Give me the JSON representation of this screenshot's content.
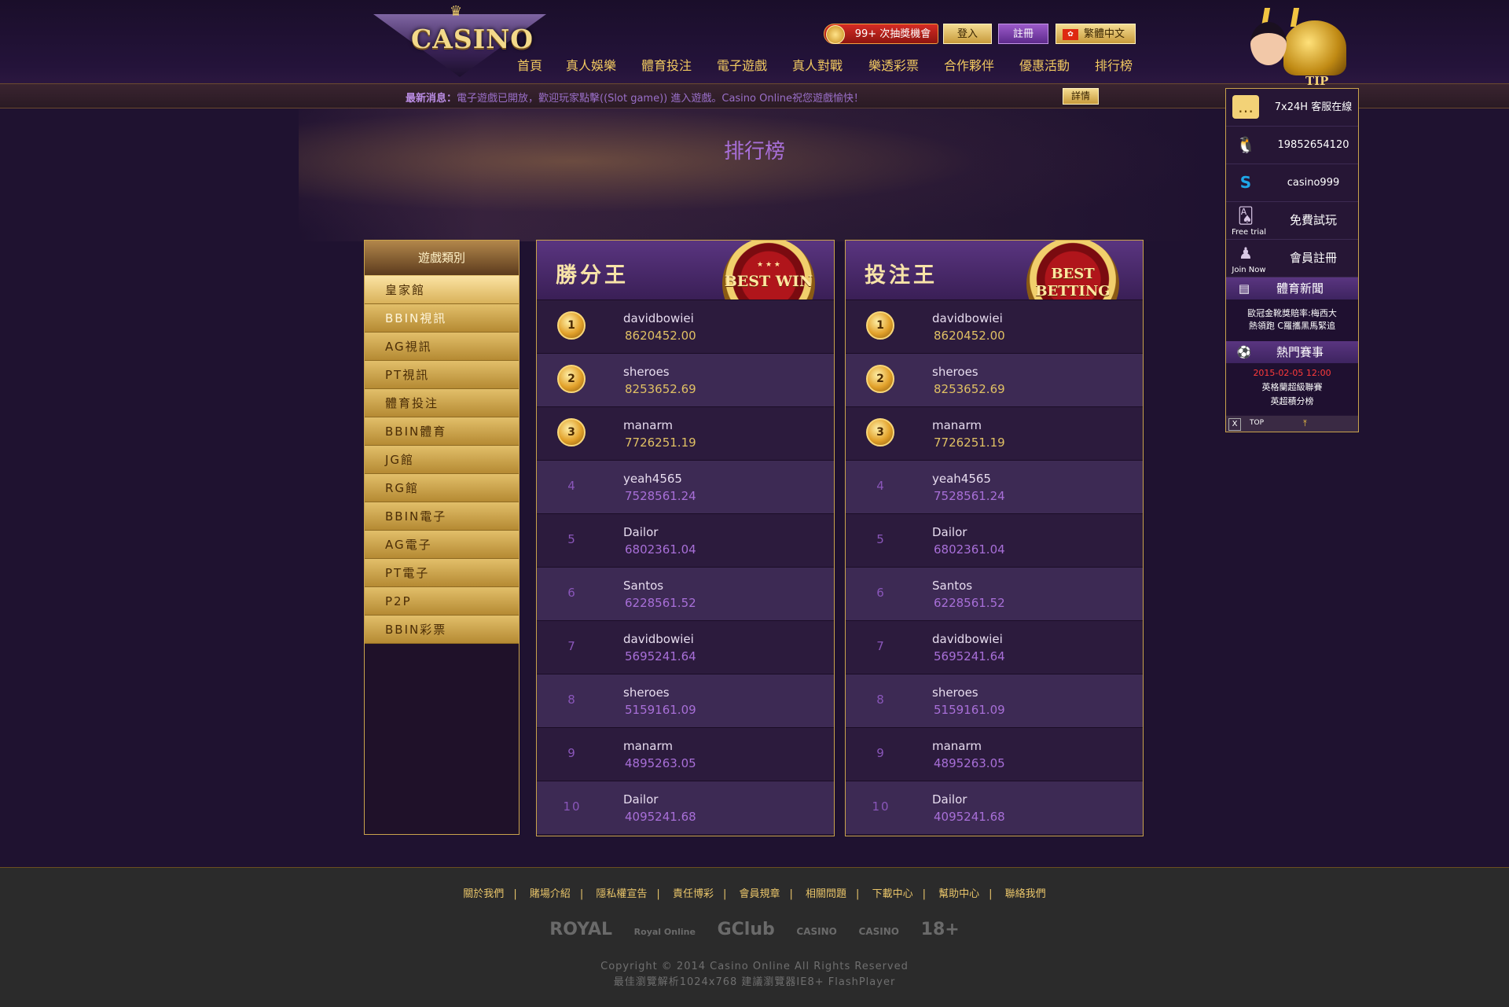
{
  "logo": {
    "text": "CASINO"
  },
  "top_buttons": {
    "lottery": "99+ 次抽獎機會",
    "login": "登入",
    "register": "註冊",
    "language": "繁體中文"
  },
  "nav": [
    "首頁",
    "真人娛樂",
    "體育投注",
    "電子遊戲",
    "真人對戰",
    "樂透彩票",
    "合作夥伴",
    "優惠活動",
    "排行榜"
  ],
  "news": {
    "label": "最新消息：",
    "text": "電子遊戲已開放，歡迎玩家點擊((Slot game)) 進入遊戲。Casino Online祝您遊戲愉快！",
    "detail": "詳情"
  },
  "page_title": "排行榜",
  "sidebar": {
    "header": "遊戲類別",
    "items": [
      "皇家館",
      "BBIN視訊",
      "AG視訊",
      "PT視訊",
      "體育投注",
      "BBIN體育",
      "JG館",
      "RG館",
      "BBIN電子",
      "AG電子",
      "PT電子",
      "P2P",
      "BBIN彩票"
    ]
  },
  "boards": {
    "win": {
      "title": "勝分王",
      "badge": "BEST WIN",
      "badge_stars": "★ ★ ★",
      "rows": [
        {
          "rank": "1",
          "name": "davidbowiei",
          "score": "8620452.00"
        },
        {
          "rank": "2",
          "name": "sheroes",
          "score": "8253652.69"
        },
        {
          "rank": "3",
          "name": "manarm",
          "score": "7726251.19"
        },
        {
          "rank": "4",
          "name": "yeah4565",
          "score": "7528561.24"
        },
        {
          "rank": "5",
          "name": "Dailor",
          "score": "6802361.04"
        },
        {
          "rank": "6",
          "name": "Santos",
          "score": "6228561.52"
        },
        {
          "rank": "7",
          "name": "davidbowiei",
          "score": "5695241.64"
        },
        {
          "rank": "8",
          "name": "sheroes",
          "score": "5159161.09"
        },
        {
          "rank": "9",
          "name": "manarm",
          "score": "4895263.05"
        },
        {
          "rank": "10",
          "name": "Dailor",
          "score": "4095241.68"
        }
      ]
    },
    "bet": {
      "title": "投注王",
      "badge": "BEST BETTING",
      "rows": [
        {
          "rank": "1",
          "name": "davidbowiei",
          "score": "8620452.00"
        },
        {
          "rank": "2",
          "name": "sheroes",
          "score": "8253652.69"
        },
        {
          "rank": "3",
          "name": "manarm",
          "score": "7726251.19"
        },
        {
          "rank": "4",
          "name": "yeah4565",
          "score": "7528561.24"
        },
        {
          "rank": "5",
          "name": "Dailor",
          "score": "6802361.04"
        },
        {
          "rank": "6",
          "name": "Santos",
          "score": "6228561.52"
        },
        {
          "rank": "7",
          "name": "davidbowiei",
          "score": "5695241.64"
        },
        {
          "rank": "8",
          "name": "sheroes",
          "score": "5159161.09"
        },
        {
          "rank": "9",
          "name": "manarm",
          "score": "4895263.05"
        },
        {
          "rank": "10",
          "name": "Dailor",
          "score": "4095241.68"
        }
      ]
    }
  },
  "float_panel": {
    "tip": "TIP",
    "service": "7x24H 客服在線",
    "qq": "19852654120",
    "skype": "casino999",
    "free_trial_sub": "Free trial",
    "free_trial": "免費試玩",
    "join_sub": "Join Now",
    "join": "會員註冊",
    "sports_news_title": "體育新聞",
    "sports_news_line1": "歐冠金靴獎賠率:梅西大",
    "sports_news_line2": "熱領跑 C羅攜黑馬緊追",
    "hot_matches_title": "熱門賽事",
    "match_date": "2015-02-05 12:00",
    "match_league": "英格蘭超級聯賽",
    "match_info": "英超積分榜",
    "close": "X",
    "top": "TOP"
  },
  "footer": {
    "links": [
      "關於我們",
      "賭場介紹",
      "隱私權宣告",
      "責任博彩",
      "會員規章",
      "相關問題",
      "下載中心",
      "幫助中心",
      "聯絡我們"
    ],
    "partners": [
      "ROYAL",
      "Royal Online",
      "GClub",
      "CASINO",
      "CASINO",
      "18+"
    ],
    "copyright": "Copyright © 2014 Casino Online All Rights Reserved",
    "browser_note": "最佳瀏覽解析1024x768 建議瀏覽器IE8+ FlashPlayer"
  }
}
